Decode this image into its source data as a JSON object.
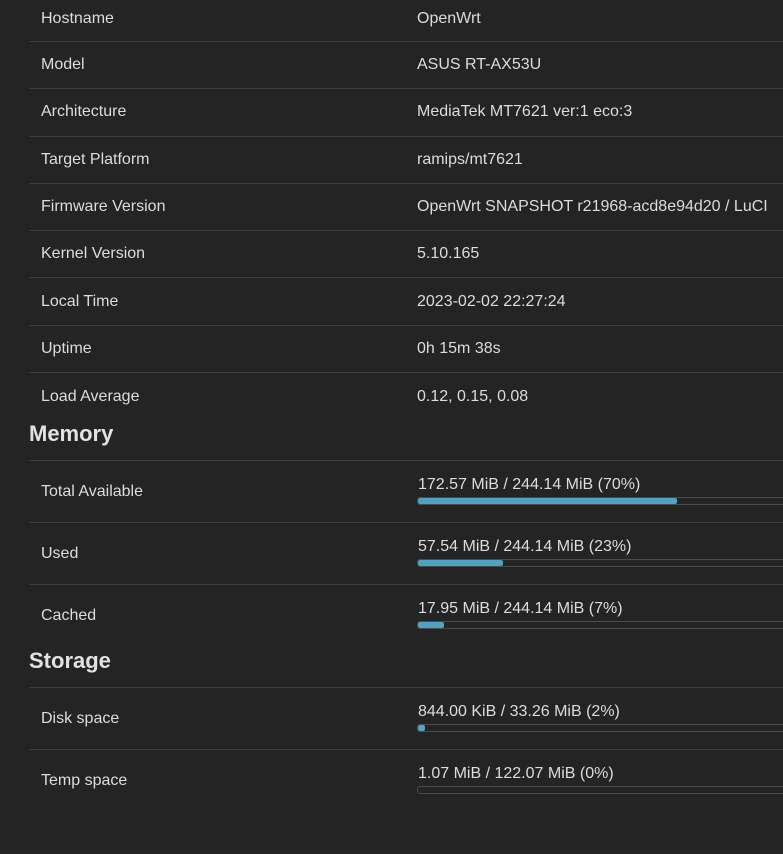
{
  "colors": {
    "background": "#242424",
    "bar_fill": "#4fa3c0",
    "divider": "#3d3d3d"
  },
  "system": [
    {
      "label": "Hostname",
      "value": "OpenWrt"
    },
    {
      "label": "Model",
      "value": "ASUS RT-AX53U"
    },
    {
      "label": "Architecture",
      "value": "MediaTek MT7621 ver:1 eco:3"
    },
    {
      "label": "Target Platform",
      "value": "ramips/mt7621"
    },
    {
      "label": "Firmware Version",
      "value": "OpenWrt SNAPSHOT r21968-acd8e94d20 / LuCI"
    },
    {
      "label": "Kernel Version",
      "value": "5.10.165"
    },
    {
      "label": "Local Time",
      "value": "2023-02-02 22:27:24"
    },
    {
      "label": "Uptime",
      "value": "0h 15m 38s"
    },
    {
      "label": "Load Average",
      "value": "0.12, 0.15, 0.08"
    }
  ],
  "memory": {
    "title": "Memory",
    "rows": [
      {
        "label": "Total Available",
        "text": "172.57 MiB / 244.14 MiB (70%)",
        "percent": 70
      },
      {
        "label": "Used",
        "text": "57.54 MiB / 244.14 MiB (23%)",
        "percent": 23
      },
      {
        "label": "Cached",
        "text": "17.95 MiB / 244.14 MiB (7%)",
        "percent": 7
      }
    ]
  },
  "storage": {
    "title": "Storage",
    "rows": [
      {
        "label": "Disk space",
        "text": "844.00 KiB / 33.26 MiB (2%)",
        "percent": 2
      },
      {
        "label": "Temp space",
        "text": "1.07 MiB / 122.07 MiB (0%)",
        "percent": 0
      }
    ]
  }
}
